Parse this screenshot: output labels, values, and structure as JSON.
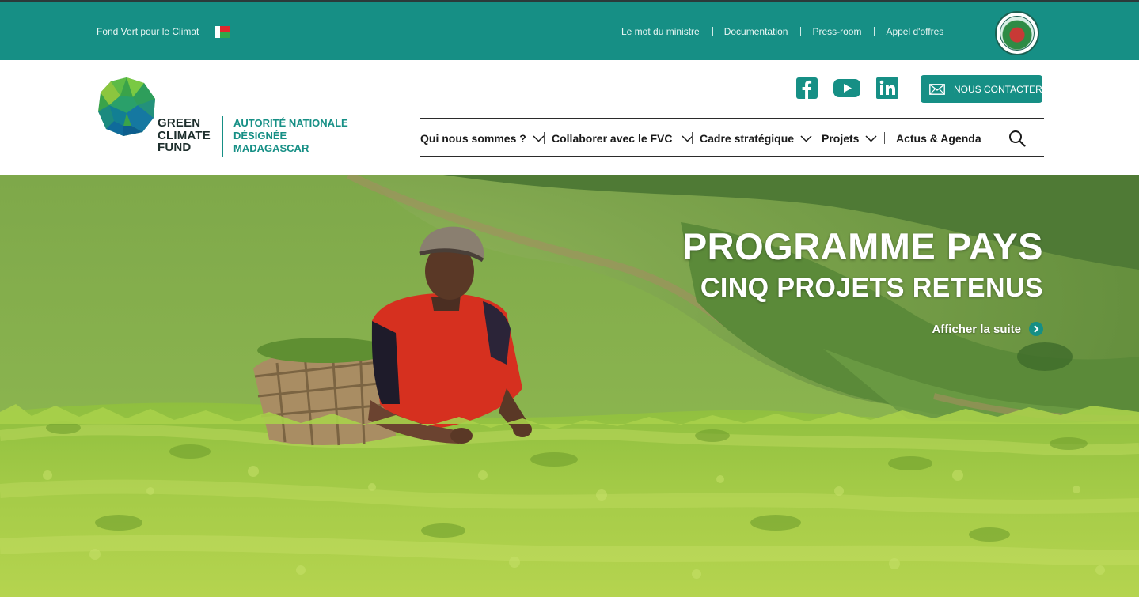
{
  "topbar": {
    "site_name": "Fond Vert pour le Climat",
    "flag_icon": "madagascar-flag-icon",
    "links": [
      "Le mot du ministre",
      "Documentation",
      "Press-room",
      "Appel d'offres"
    ],
    "seal_icon": "ministry-seal-icon"
  },
  "header": {
    "logo": {
      "line1": "GREEN",
      "line2": "CLIMATE",
      "line3": "FUND"
    },
    "authority": {
      "line1": "AUTORITÉ NATIONALE",
      "line2": "DÉSIGNÉE",
      "line3": "MADAGASCAR"
    },
    "social": [
      "facebook-icon",
      "youtube-icon",
      "linkedin-icon"
    ],
    "contact_label": "NOUS CONTACTER"
  },
  "nav": {
    "items": [
      {
        "label": "Qui nous sommes ?",
        "has_dropdown": true
      },
      {
        "label": "Collaborer avec le FVC",
        "has_dropdown": true
      },
      {
        "label": "Cadre stratégique",
        "has_dropdown": true
      },
      {
        "label": "Projets",
        "has_dropdown": true
      },
      {
        "label": "Actus & Agenda",
        "has_dropdown": false
      }
    ],
    "search_icon": "search-icon"
  },
  "hero": {
    "title": "PROGRAMME PAYS",
    "subtitle": "CINQ PROJETS RETENUS",
    "link_label": "Afficher la suite"
  },
  "colors": {
    "brand_teal": "#168f85",
    "text_dark": "#1a1a1a"
  }
}
